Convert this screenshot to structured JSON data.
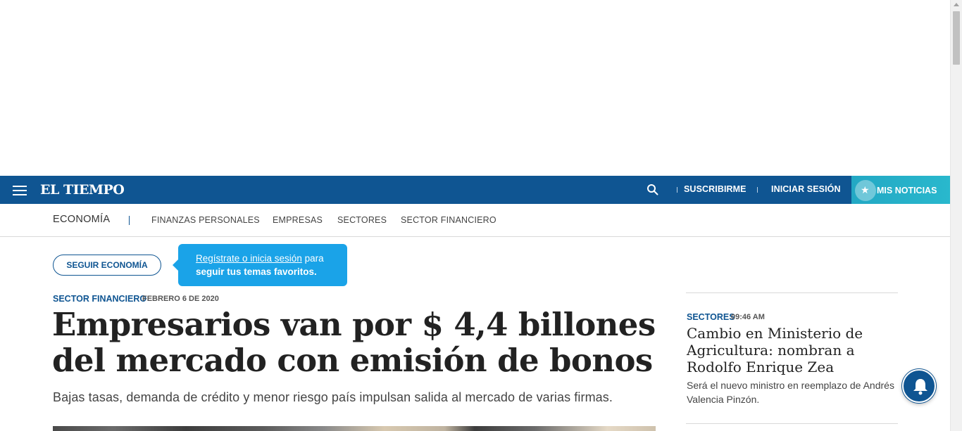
{
  "brand": {
    "name": "EL TIEMPO"
  },
  "header": {
    "subscribe_label": "SUSCRIBIRME",
    "login_label": "INICIAR SESIÓN",
    "my_news_label": "MIS NOTICIAS"
  },
  "section": {
    "title": "ECONOMÍA",
    "subnav": [
      "FINANZAS PERSONALES",
      "EMPRESAS",
      "SECTORES",
      "SECTOR FINANCIERO"
    ]
  },
  "follow": {
    "button_label": "SEGUIR ECONOMÍA",
    "tooltip_link": "Regístrate o inicia sesión",
    "tooltip_text_1": " para",
    "tooltip_text_2": "seguir tus temas favoritos."
  },
  "article": {
    "category": "SECTOR FINANCIERO",
    "date": "FEBRERO 6 DE 2020",
    "headline": "Empresarios van por $ 4,4 billones del mercado con emisión de bonos",
    "lead": "Bajas tasas, demanda de crédito y menor riesgo país impulsan salida al mercado de varias firmas."
  },
  "sidebar": {
    "category": "SECTORES",
    "time": "09:46 AM",
    "headline": "Cambio en Ministerio de Agricultura: nombran a Rodolfo Enrique Zea",
    "summary": "Será el nuevo ministro en reemplazo de Andrés Valencia Pinzón."
  },
  "icons": {
    "menu": "hamburger-menu-icon",
    "search": "search-icon",
    "star": "star-icon",
    "bell": "bell-icon"
  },
  "colors": {
    "brand_blue": "#0f5592",
    "accent_teal": "#29b8cd",
    "tooltip_blue": "#1aa3e8"
  }
}
